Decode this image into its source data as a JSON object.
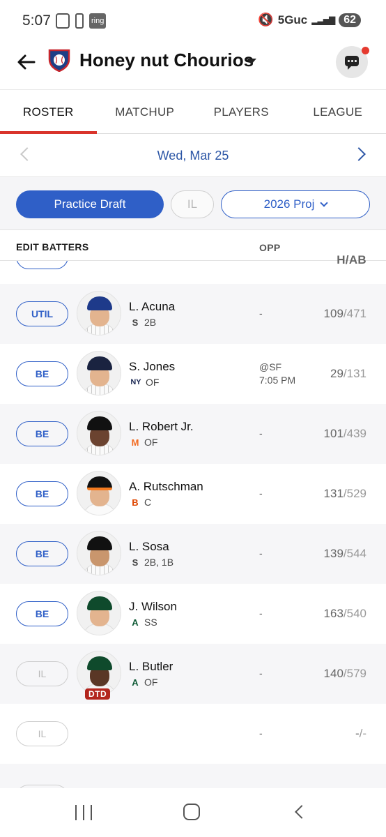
{
  "status_bar": {
    "time": "5:07",
    "ring_label": "ring",
    "network": "5Guc",
    "battery": "62"
  },
  "header": {
    "team_name": "Honey nut Chourios",
    "team_logo_icon": "baseball-shield-icon",
    "back_icon": "back-arrow-icon",
    "chat_icon": "chat-icon"
  },
  "tabs": [
    {
      "label": "ROSTER",
      "active": true
    },
    {
      "label": "MATCHUP",
      "active": false
    },
    {
      "label": "PLAYERS",
      "active": false
    },
    {
      "label": "LEAGUE",
      "active": false
    }
  ],
  "date_nav": {
    "date": "Wed, Mar 25"
  },
  "filters": {
    "draft_label": "Practice Draft",
    "il_label": "IL",
    "proj_label": "2026 Proj"
  },
  "table_header": {
    "edit": "EDIT BATTERS",
    "opp": "OPP",
    "hab": "H/AB"
  },
  "rows": [
    {
      "slot": "UTIL",
      "name": "L. Acuna",
      "team": "CWS",
      "team_glyph": "S",
      "pos": "2B",
      "opp_line1": "-",
      "opp_line2": "",
      "h": "109",
      "ab": "/471",
      "status": ""
    },
    {
      "slot": "BE",
      "name": "S. Jones",
      "team": "NYY",
      "team_glyph": "NY",
      "pos": "OF",
      "opp_line1": "@SF",
      "opp_line2": "7:05 PM",
      "h": "29",
      "ab": "/131",
      "status": ""
    },
    {
      "slot": "BE",
      "name": "L. Robert Jr.",
      "team": "NYM",
      "team_glyph": "M",
      "pos": "OF",
      "opp_line1": "-",
      "opp_line2": "",
      "h": "101",
      "ab": "/439",
      "status": ""
    },
    {
      "slot": "BE",
      "name": "A. Rutschman",
      "team": "BAL",
      "team_glyph": "B",
      "pos": "C",
      "opp_line1": "-",
      "opp_line2": "",
      "h": "131",
      "ab": "/529",
      "status": ""
    },
    {
      "slot": "BE",
      "name": "L. Sosa",
      "team": "CWS",
      "team_glyph": "S",
      "pos": "2B, 1B",
      "opp_line1": "-",
      "opp_line2": "",
      "h": "139",
      "ab": "/544",
      "status": ""
    },
    {
      "slot": "BE",
      "name": "J. Wilson",
      "team": "ATH",
      "team_glyph": "A",
      "pos": "SS",
      "opp_line1": "-",
      "opp_line2": "",
      "h": "163",
      "ab": "/540",
      "status": ""
    },
    {
      "slot": "IL",
      "name": "L. Butler",
      "team": "ATH",
      "team_glyph": "A",
      "pos": "OF",
      "opp_line1": "-",
      "opp_line2": "",
      "h": "140",
      "ab": "/579",
      "status": "DTD"
    },
    {
      "slot": "IL",
      "name": "",
      "team": "",
      "team_glyph": "",
      "pos": "",
      "opp_line1": "-",
      "opp_line2": "",
      "h": "-",
      "ab": "/-",
      "status": ""
    }
  ],
  "colors": {
    "accent_blue": "#2f5fc7",
    "tab_underline": "#d9342b",
    "dtd_badge": "#b3261e"
  }
}
